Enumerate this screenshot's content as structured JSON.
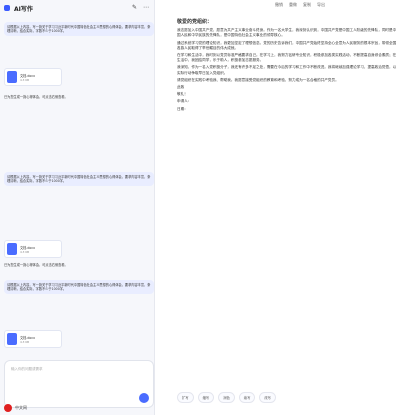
{
  "app": {
    "title": "AI写作"
  },
  "top_actions": {
    "new": "✎",
    "more": "⋯"
  },
  "left": {
    "messages": [
      {
        "text": "请根据以上内容，写一篇关于学习习近平新时代中国特色社会主义思想的心得体会，要求内容丰富，条理清晰，结合实际，字数不少于1000字。"
      },
      {
        "text": "请根据以上内容，写一篇关于学习习近平新时代中国特色社会主义思想的心得体会，要求内容丰富，条理清晰，结合实际，字数不少于1000字。"
      },
      {
        "text": "请根据以上内容，写一篇关于学习习近平新时代中国特色社会主义思想的心得体会，要求内容丰富，条理清晰，结合实际，字数不少于1000字。"
      }
    ],
    "files": [
      {
        "name": "文档.docx",
        "meta": "4.3 KB"
      },
      {
        "name": "文档.docx",
        "meta": "4.3 KB"
      },
      {
        "name": "文档.docx",
        "meta": "4.3 KB"
      }
    ],
    "assistant_lines": [
      "已为您生成一篇心得体会，可点击右侧查看。",
      "已为您生成一篇心得体会，可点击右侧查看。"
    ],
    "input_placeholder": "输入你的问题或需求"
  },
  "brand": {
    "text": "中文网"
  },
  "doc": {
    "toolbar": [
      "撤销",
      "重做",
      "复制",
      "导出"
    ],
    "title": "敬爱的党组织：",
    "paragraphs": [
      "我志愿加入中国共产党，愿意为共产主义事业奋斗终身。作为一名大学生，我深刻认识到，中国共产党是中国工人阶级的先锋队，同时是中国人民和中华民族的先锋队，是中国特色社会主义事业的领导核心。",
      "通过系统学习党的理论知识，我更加坚定了理想信念。党的历史告诉我们，中国共产党始终坚持全心全意为人民服务的根本宗旨，带领全国各族人民取得了举世瞩目的伟大成就。",
      "在学习和生活中，我时刻以党员标准严格要求自己。在学习上，我努力钻研专业知识，积极参加各类实践活动，不断提高自身综合素质；在生活中，我团结同学，乐于助人，积极参加志愿服务。",
      "我深知，作为一名入党积极分子，我还有许多不足之处，需要在今后的学习和工作中不断改进。我将继续加强理论学习，提高政治觉悟，以实际行动争取早日加入党组织。",
      "请党组织在实践中考验我、帮助我。我愿意接受党组织的教育和考验，努力成为一名合格的共产党员。"
    ],
    "closing": "此致",
    "salute": "敬礼！",
    "signature": "申请人：",
    "date": "日期：",
    "chips": [
      "扩写",
      "缩写",
      "润色",
      "续写",
      "改写"
    ]
  }
}
